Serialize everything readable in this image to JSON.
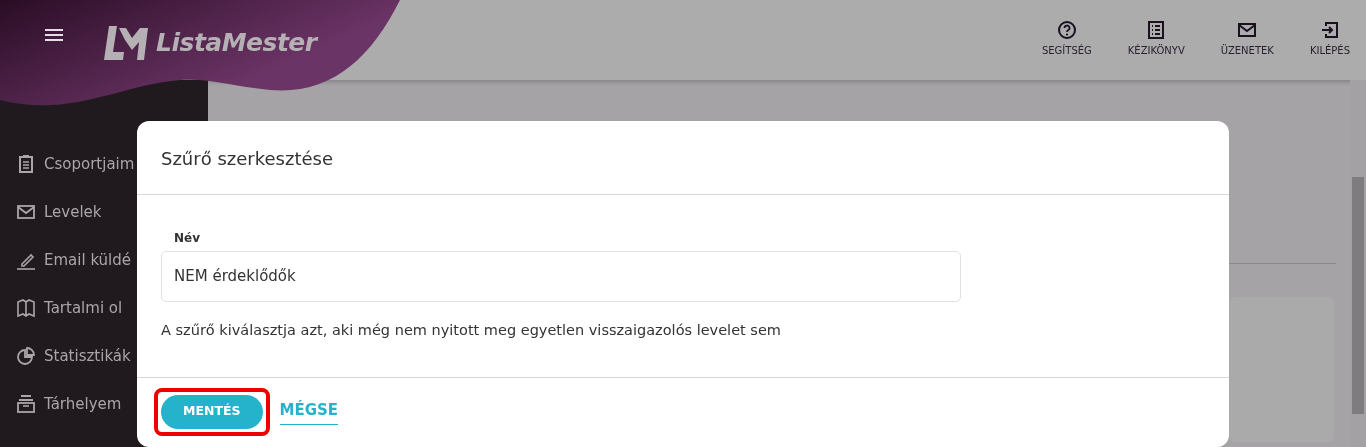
{
  "header": {
    "logo_text": "ListaMester",
    "actions": [
      {
        "label": "SEGÍTSÉG",
        "kind": "help"
      },
      {
        "label": "KÉZIKÖNYV",
        "kind": "list"
      },
      {
        "label": "ÜZENETEK",
        "kind": "mail"
      },
      {
        "label": "KILÉPÉS",
        "kind": "exit"
      }
    ]
  },
  "sidebar": {
    "items": [
      {
        "label": "Csoportjaim",
        "kind": "clipboard"
      },
      {
        "label": "Levelek",
        "kind": "mail"
      },
      {
        "label": "Email küldé",
        "kind": "pencil"
      },
      {
        "label": "Tartalmi ol",
        "kind": "book"
      },
      {
        "label": "Statisztikák",
        "kind": "pie"
      },
      {
        "label": "Tárhelyem",
        "kind": "tray"
      }
    ]
  },
  "modal": {
    "title": "Szűrő szerkesztése",
    "field": {
      "label": "Név",
      "value": "NEM érdeklődők"
    },
    "help_text": "A szűrő kiválasztja azt, aki még nem nyitott meg egyetlen visszaigazolós levelet sem",
    "buttons": [
      {
        "label": "MENTÉS",
        "kind": "primary",
        "highlighted": true
      },
      {
        "label": "MÉGSE",
        "kind": "link",
        "highlighted": false
      }
    ]
  }
}
